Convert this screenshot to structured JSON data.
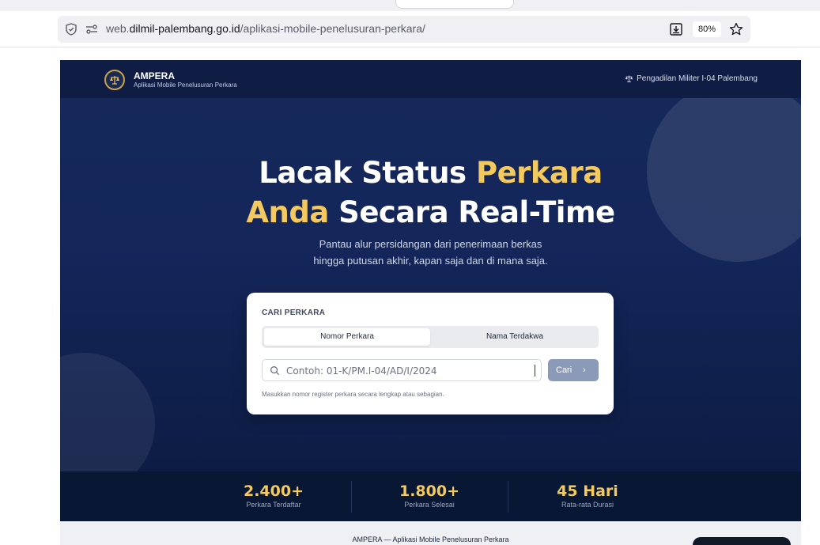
{
  "browser": {
    "url_prefix": "web.",
    "url_host": "dilmil-palembang.go.id",
    "url_path": "/aplikasi-mobile-penelusuran-perkara/",
    "zoom": "80%",
    "icons": [
      "shield-icon",
      "permissions-icon",
      "download-icon",
      "bookmark-star-icon"
    ]
  },
  "nav": {
    "brand": "AMPERA",
    "brand_sub": "Aplikasi Mobile Penelusuran Perkara",
    "court": "Pengadilan Militer I-04 Palembang"
  },
  "hero": {
    "line1_a": "Lacak Status ",
    "line1_b": "Perkara",
    "line2_a": "Anda",
    "line2_b": " Secara Real-Time",
    "sub_line1": "Pantau alur persidangan dari penerimaan berkas",
    "sub_line2": "hingga putusan akhir, kapan saja dan di mana saja."
  },
  "search": {
    "title": "CARI PERKARA",
    "tabs": [
      {
        "label": "Nomor Perkara",
        "active": true
      },
      {
        "label": "Nama Terdakwa",
        "active": false
      }
    ],
    "placeholder": "Contoh: 01-K/PM.I-04/AD/I/2024",
    "button": "Cari",
    "hint": "Masukkan nomor register perkara secara lengkap atau sebagian."
  },
  "stats": [
    {
      "value": "2.400+",
      "label": "Perkara Terdaftar"
    },
    {
      "value": "1.800+",
      "label": "Perkara Selesai"
    },
    {
      "value": "45 Hari",
      "label": "Rata-rata Durasi"
    }
  ],
  "footer": "AMPERA — Aplikasi Mobile Penelusuran Perkara",
  "colors": {
    "accent_gold": "#f4c95d",
    "hero_navy": "#14265a",
    "stats_bar": "#081734",
    "button": "#8b9bb7"
  }
}
